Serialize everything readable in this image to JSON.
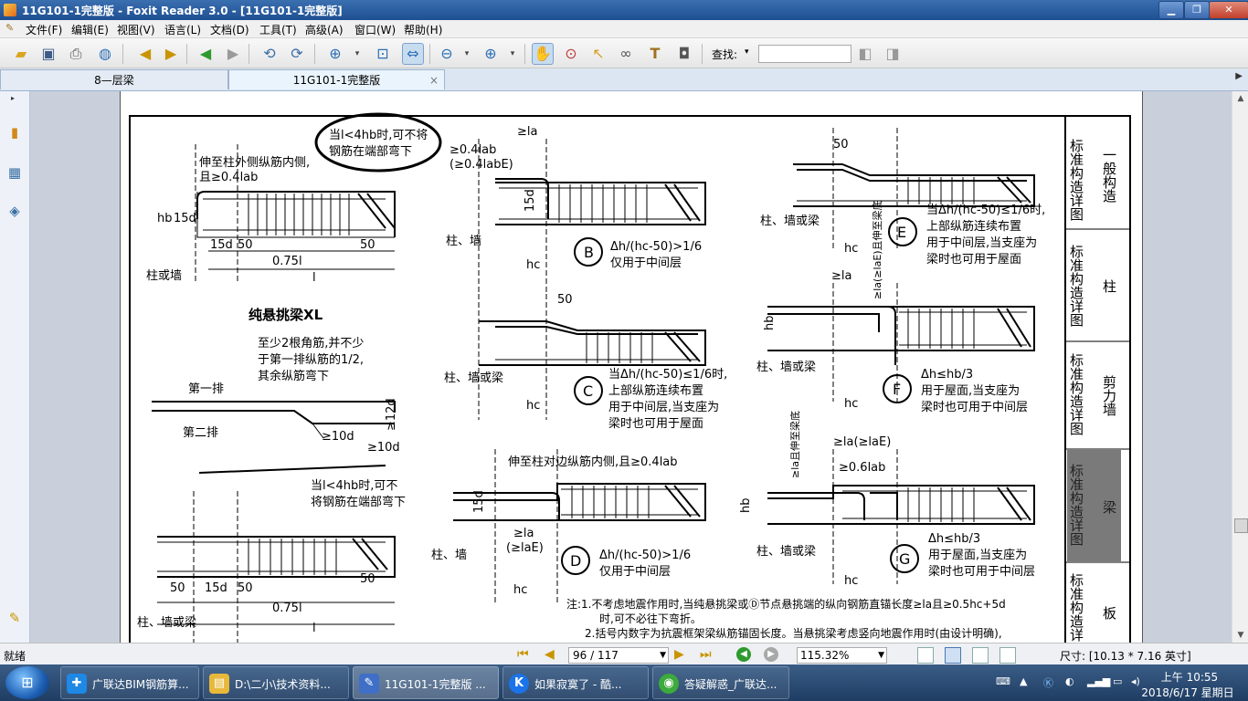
{
  "window": {
    "title": "11G101-1完整版 - Foxit Reader 3.0 - [11G101-1完整版]",
    "minimize": "▁",
    "restore": "❐",
    "close": "✕"
  },
  "menu": {
    "items": [
      "文件(F)",
      "编辑(E)",
      "视图(V)",
      "语言(L)",
      "文档(D)",
      "工具(T)",
      "高级(A)",
      "窗口(W)",
      "帮助(H)"
    ]
  },
  "toolbar": {
    "find_label": "查找:",
    "find_value": ""
  },
  "tabs": {
    "items": [
      {
        "label": "8—层梁",
        "active": false
      },
      {
        "label": "11G101-1完整版",
        "active": true
      }
    ],
    "close": "×"
  },
  "document": {
    "top_callout": [
      "当l<4hb时,可不将",
      "钢筋在端部弯下"
    ],
    "pure_cantilever": {
      "note1": [
        "伸至柱外侧纵筋内侧,",
        "且≥0.4lab"
      ],
      "dims_row": [
        "15d",
        "50",
        "0.75l",
        "50"
      ],
      "span": "l",
      "support": "柱或墙",
      "hb": "hb",
      "d15": "15d",
      "heading": "纯悬挑梁XL",
      "bend_note": [
        "至少2根角筋,并不少",
        "于第一排纵筋的1/2,",
        "其余纵筋弯下"
      ],
      "row1": "第一排",
      "row2": "第二排",
      "bend_12d": "≥12d",
      "bend_10d_a": "≥10d",
      "bend_10d_b": "≥10d"
    },
    "lower_cantilever": {
      "callout": [
        "当l<4hb时,可不",
        "将钢筋在端部弯下"
      ],
      "dims_row": [
        "50",
        "15d",
        "50",
        "0.75l",
        "50"
      ],
      "span": "l",
      "support": "柱、墙或梁"
    },
    "node_B": {
      "letter": "B",
      "anchor": "≥la",
      "anchor2": [
        "≥0.4lab",
        "(≥0.4labE)"
      ],
      "support": "柱、墙",
      "hc": "hc",
      "d15": "15d",
      "text": [
        "Δh/(hc-50)>1/6",
        "仅用于中间层"
      ]
    },
    "node_C": {
      "letter": "C",
      "top": "50",
      "support": "柱、墙或梁",
      "hc": "hc",
      "text": [
        "当Δh/(hc-50)≤1/6时,",
        "上部纵筋连续布置",
        "用于中间层,当支座为",
        "梁时也可用于屋面"
      ]
    },
    "node_D": {
      "letter": "D",
      "top_note": "伸至柱对边纵筋内侧,且≥0.4lab",
      "anchor": [
        "≥la",
        "(≥laE)"
      ],
      "support": "柱、墙",
      "hc": "hc",
      "d15": "15d",
      "text": [
        "Δh/(hc-50)>1/6",
        "仅用于中间层"
      ]
    },
    "node_E": {
      "letter": "E",
      "top": "50",
      "support": "柱、墙或梁",
      "hc": "hc",
      "text": [
        "当Δh/(hc-50)≤1/6时,",
        "上部纵筋连续布置",
        "用于中间层,当支座为",
        "梁时也可用于屋面"
      ]
    },
    "node_F": {
      "letter": "F",
      "anchor": "≥la",
      "vert": "≥la(≥laE)且伸至梁底",
      "support": "柱、墙或梁",
      "hc": "hc",
      "hb": "hb",
      "text": [
        "Δh≤hb/3",
        "用于屋面,当支座为",
        "梁时也可用于中间层"
      ]
    },
    "node_G": {
      "letter": "G",
      "anchor": "≥la(≥laE)",
      "anchor2": "≥0.6lab",
      "vert": "≥la且伸至梁底",
      "support": "柱、墙或梁",
      "hc": "hc",
      "hb": "hb",
      "text": [
        "Δh≤hb/3",
        "用于屋面,当支座为",
        "梁时也可用于中间层"
      ]
    },
    "notes": [
      "注:1.不考虑地震作用时,当纯悬挑梁或Ⓓ节点悬挑端的纵向钢筋直锚长度≥la且≥0.5hc+5d",
      "时,可不必往下弯折。",
      "2.括号内数字为抗震框架梁纵筋锚固长度。当悬挑梁考虑竖向地震作用时(由设计明确),"
    ],
    "side_index": [
      {
        "left": "标准构造详图",
        "right": "一般构造",
        "active": false
      },
      {
        "left": "标准构造详图",
        "right": "柱",
        "active": false
      },
      {
        "left": "标准构造详图",
        "right": "剪力墙",
        "active": false
      },
      {
        "left": "标准构造详图",
        "right": "梁",
        "active": true
      },
      {
        "left": "标准构造详",
        "right": "板",
        "active": false
      }
    ]
  },
  "status": {
    "ready": "就绪",
    "page_display": "96 / 117",
    "zoom": "115.32%",
    "size": "尺寸: [10.13 * 7.16 英寸]"
  },
  "taskbar": {
    "tasks": [
      {
        "label": "广联达BIM钢筋算...",
        "icon": "✚",
        "color": "#1e88e5"
      },
      {
        "label": "D:\\二小\\技术资料...",
        "icon": "▤",
        "color": "#e8b83a"
      },
      {
        "label": "11G101-1完整版 ...",
        "icon": "✎",
        "color": "#3f6fc7",
        "active": true
      },
      {
        "label": "如果寂寞了 - 酷...",
        "icon": "K",
        "color": "#1a73e8"
      },
      {
        "label": "答疑解惑_广联达...",
        "icon": "◉",
        "color": "#3caa3c"
      }
    ],
    "time": "上午 10:55",
    "date": "2018/6/17 星期日"
  }
}
